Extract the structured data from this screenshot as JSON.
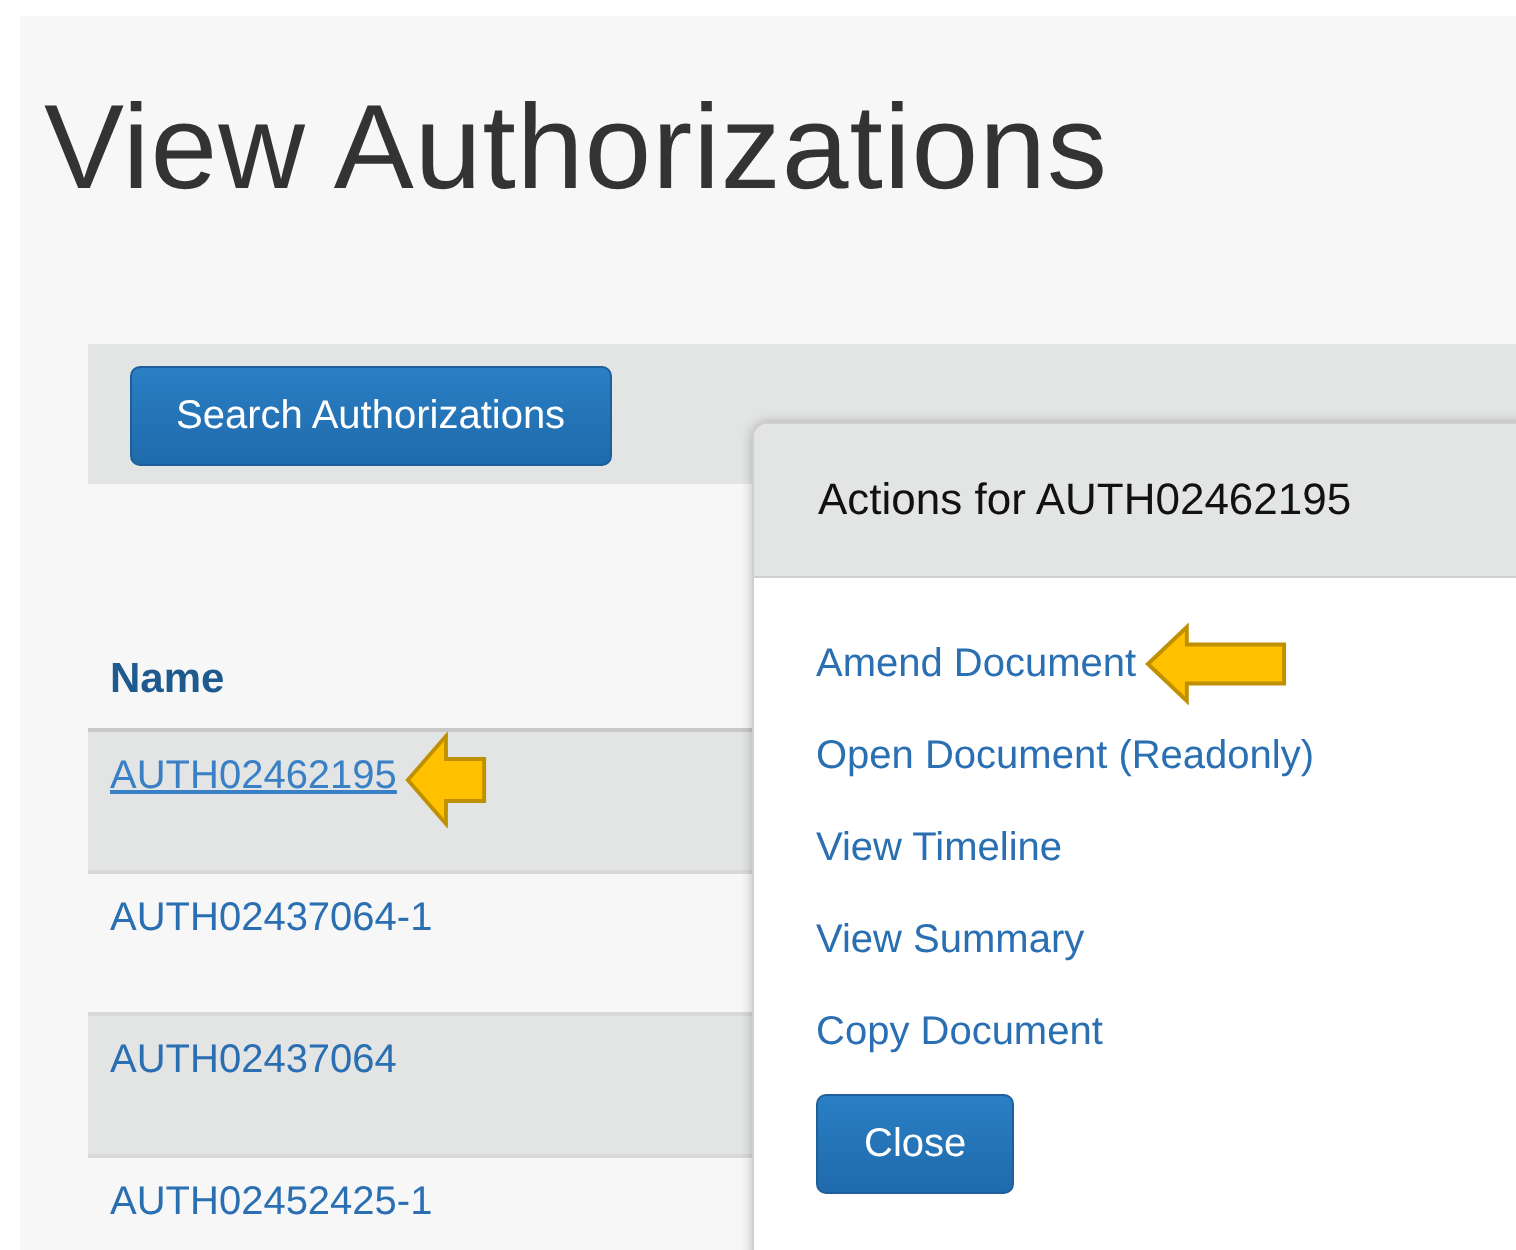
{
  "page": {
    "title": "View Authorizations"
  },
  "toolbar": {
    "search_button": "Search Authorizations"
  },
  "table": {
    "columns": [
      "Name"
    ],
    "rows": [
      {
        "name": "AUTH02462195",
        "underlined": true,
        "pointer_arrow": true
      },
      {
        "name": "AUTH02437064-1",
        "underlined": false,
        "pointer_arrow": false
      },
      {
        "name": "AUTH02437064",
        "underlined": false,
        "pointer_arrow": false
      },
      {
        "name": "AUTH02452425-1",
        "underlined": false,
        "pointer_arrow": false
      }
    ]
  },
  "actions_popup": {
    "title": "Actions for AUTH02462195",
    "actions": [
      {
        "label": "Amend Document",
        "pointer_arrow": true
      },
      {
        "label": "Open Document (Readonly)",
        "pointer_arrow": false
      },
      {
        "label": "View Timeline",
        "pointer_arrow": false
      },
      {
        "label": "View Summary",
        "pointer_arrow": false
      },
      {
        "label": "Copy Document",
        "pointer_arrow": false
      }
    ],
    "close_button": "Close"
  }
}
